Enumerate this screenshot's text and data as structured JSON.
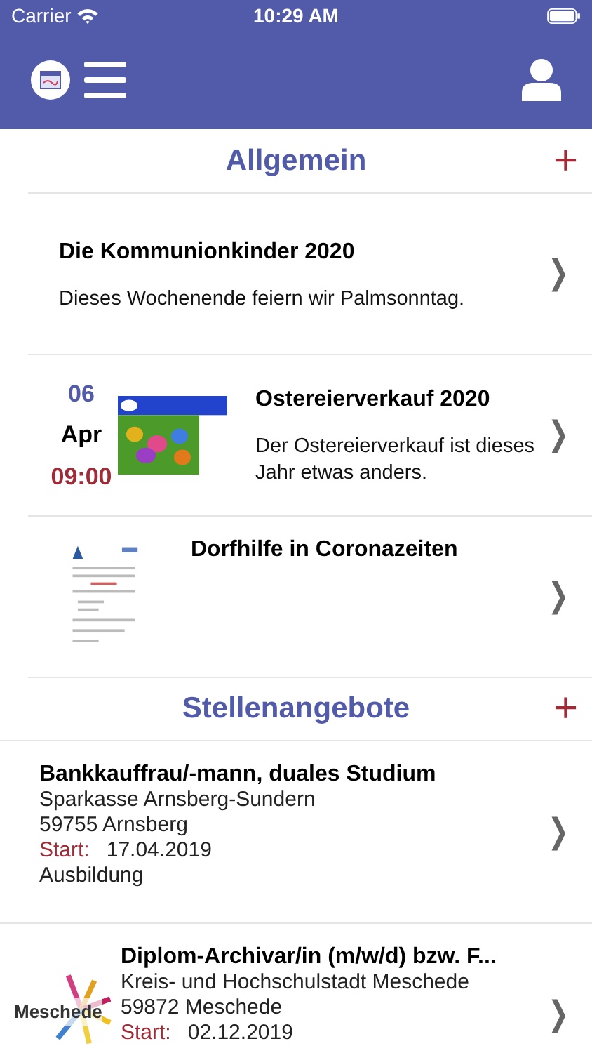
{
  "status_bar": {
    "carrier": "Carrier",
    "time": "10:29 AM"
  },
  "sections": [
    {
      "title": "Allgemein",
      "add": "+",
      "items": [
        {
          "kind": "news",
          "title": "Die Kommunionkinder 2020",
          "text": "Dieses Wochenende feiern wir Palmsonntag.",
          "chevron": "❯"
        },
        {
          "kind": "event",
          "day": "06",
          "month": "Apr",
          "time": "09:00",
          "title": "Ostereierverkauf 2020",
          "text": "Der Ostereierverkauf ist dieses Jahr etwas anders.",
          "chevron": "❯"
        },
        {
          "kind": "news",
          "title": "Dorfhilfe in Coronazeiten",
          "chevron": "❯"
        }
      ]
    },
    {
      "title": "Stellenangebote",
      "add": "+",
      "items": [
        {
          "kind": "job",
          "title": "Bankkauffrau/-mann, duales Studium",
          "employer": "Sparkasse Arnsberg-Sundern",
          "city": "59755 Arnsberg",
          "start_label": "Start:",
          "start": "17.04.2019",
          "type": "Ausbildung",
          "chevron": "❯"
        },
        {
          "kind": "job",
          "logo_text": "Meschede",
          "title": "Diplom-Archivar/in (m/w/d) bzw. F...",
          "employer": "Kreis- und Hochschulstadt Meschede",
          "city": "59872 Meschede",
          "start_label": "Start:",
          "start": "02.12.2019",
          "chevron": "❯"
        }
      ]
    }
  ]
}
